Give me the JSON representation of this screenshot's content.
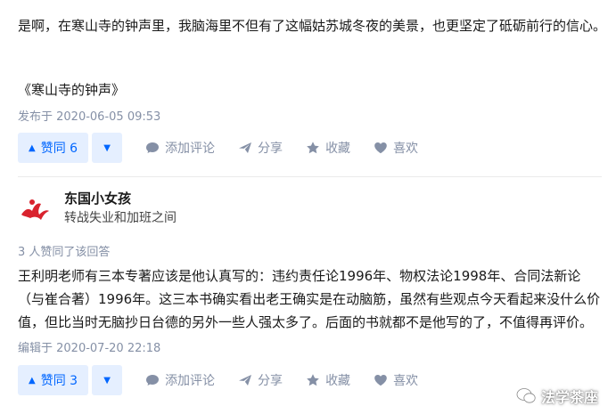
{
  "answer1": {
    "paragraph": "是啊，在寒山寺的钟声里，我脑海里不但有了这幅姑苏城冬夜的美景，也更坚定了砥砺前行的信心。",
    "book_title": "《寒山寺的钟声》",
    "meta": "发布于 2020-06-05 09:53",
    "actions": {
      "upvote_label": "赞同 6",
      "comment_label": "添加评论",
      "share_label": "分享",
      "collect_label": "收藏",
      "like_label": "喜欢"
    }
  },
  "answer2": {
    "author_name": "东国小女孩",
    "author_bio": "转战失业和加班之间",
    "upvote_note": "3 人赞同了该回答",
    "paragraph": "王利明老师有三本专著应该是他认真写的：违约责任论1996年、物权法论1998年、合同法新论（与崔合著）1996年。这三本书确实看出老王确实是在动脑筋，虽然有些观点今天看起来没什么价值，但比当时无脑抄日台德的另外一些人强太多了。后面的书就都不是他写的了，不值得再评价。",
    "meta": "编辑于 2020-07-20 22:18",
    "actions": {
      "upvote_label": "赞同 3",
      "comment_label": "添加评论",
      "share_label": "分享",
      "collect_label": "收藏",
      "like_label": "喜欢"
    }
  },
  "watermark": {
    "text": "法学茶座"
  },
  "colors": {
    "accent": "#0066ff",
    "accent_bg": "#e5efff",
    "meta": "#8590a6",
    "avatar_red": "#d9232e"
  }
}
